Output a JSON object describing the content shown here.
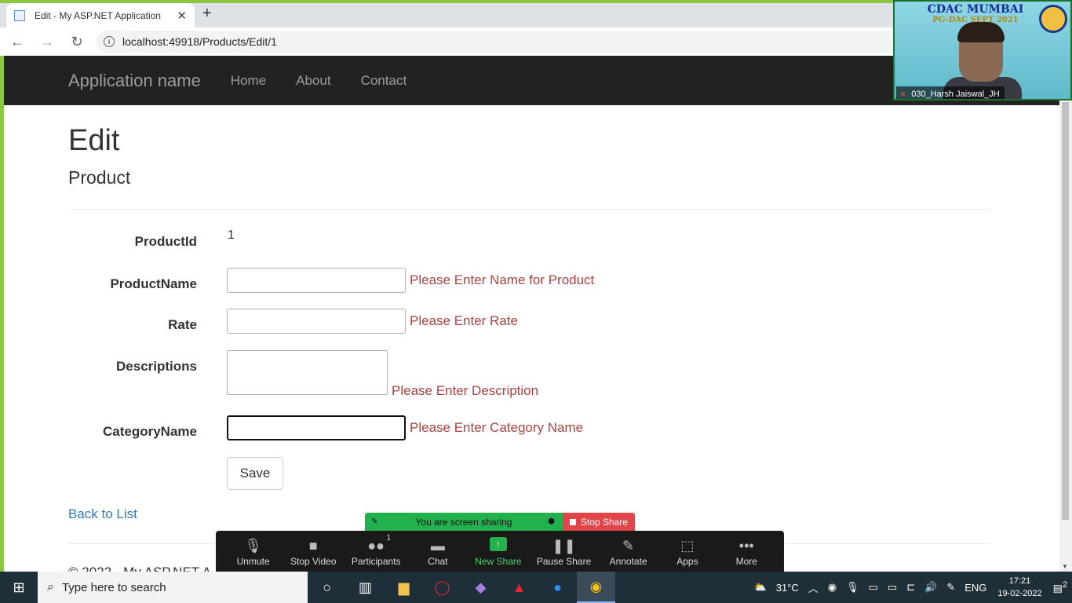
{
  "browser": {
    "tab_title": "Edit - My ASP.NET Application",
    "tab_close": "✕",
    "new_tab": "+",
    "back": "←",
    "forward": "→",
    "reload": "↻",
    "url": "localhost:49918/Products/Edit/1"
  },
  "navbar": {
    "brand": "Application name",
    "links": [
      "Home",
      "About",
      "Contact"
    ]
  },
  "page": {
    "heading": "Edit",
    "subheading": "Product",
    "fields": {
      "product_id_label": "ProductId",
      "product_id_value": "1",
      "product_name_label": "ProductName",
      "product_name_error": "Please Enter Name for Product",
      "rate_label": "Rate",
      "rate_error": "Please Enter Rate",
      "descriptions_label": "Descriptions",
      "descriptions_error": "Please Enter Description",
      "category_label": "CategoryName",
      "category_error": "Please Enter Category Name"
    },
    "save_label": "Save",
    "back_link": "Back to List",
    "footer": "© 2022 - My ASP.NET A"
  },
  "video": {
    "line1": "CDAC MUMBAI",
    "line2": "PG-DAC SEPT 2021",
    "participant": "030_Harsh Jaiswal_JH"
  },
  "sharebar": {
    "status": "You are screen sharing",
    "stop": "Stop Share"
  },
  "zoombar": {
    "unmute": "Unmute",
    "stop_video": "Stop Video",
    "participants": "Participants",
    "participants_count": "1",
    "chat": "Chat",
    "new_share": "New Share",
    "pause_share": "Pause Share",
    "annotate": "Annotate",
    "apps": "Apps",
    "more": "More"
  },
  "taskbar": {
    "search_placeholder": "Type here to search",
    "temperature": "31°C",
    "language": "ENG",
    "time": "17:21",
    "date": "19-02-2022",
    "notifications": "2"
  },
  "colors": {
    "error": "#a94442",
    "link": "#337ab7",
    "navbar_bg": "#222222",
    "zoom_green": "#22b14c",
    "zoom_red": "#e0454a"
  }
}
